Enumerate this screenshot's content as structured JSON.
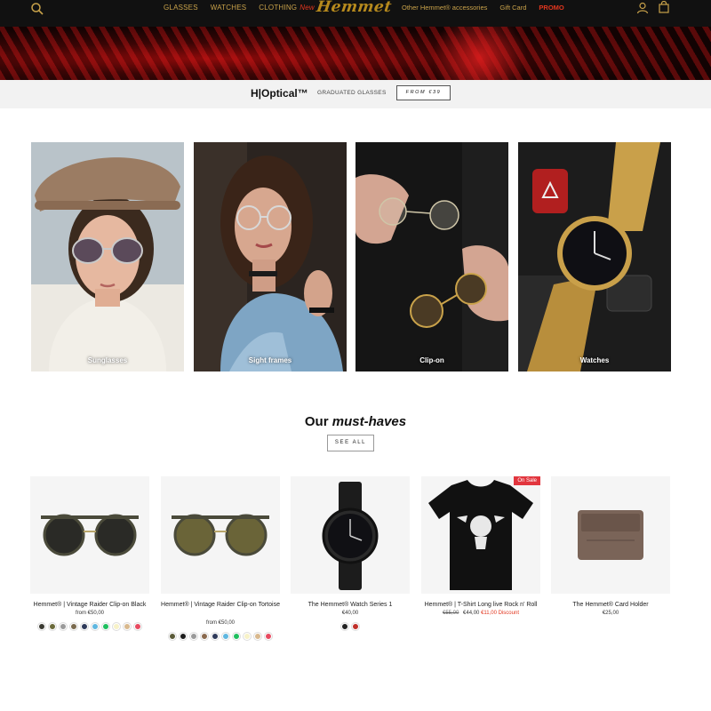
{
  "header": {
    "nav_left": [
      "GLASSES",
      "WATCHES",
      "CLOTHING"
    ],
    "clothing_badge": "New",
    "logo_text": "Hemmet",
    "nav_right": [
      "Other Hemmet® accessories",
      "Gift Card"
    ],
    "promo": "PROMO",
    "icons": [
      "search-icon",
      "account-icon",
      "cart-icon"
    ]
  },
  "optical": {
    "brand": "H|Optical™",
    "subtitle": "GRADUATED GLASSES",
    "button": "FROM €39"
  },
  "categories": [
    {
      "label": "Sunglasses"
    },
    {
      "label": "Sight frames"
    },
    {
      "label": "Clip-on"
    },
    {
      "label": "Watches"
    }
  ],
  "must_haves": {
    "title_prefix": "Our",
    "title_emph": "must-haves",
    "see_all": "SEE ALL"
  },
  "products": [
    {
      "name": "Hemmet® | Vintage Raider Clip-on Black",
      "price": "from €50,00",
      "swatches": [
        "#3a3a32",
        "#6b6a3a",
        "#9a9a9a",
        "#7a6a4e",
        "#2e3a5a",
        "#5fb7e0",
        "#1fbf5f",
        "#f7f2c8",
        "#d9b98e",
        "#e84a60"
      ]
    },
    {
      "name": "Hemmet® | Vintage Raider Clip-on Tortoise",
      "price": "from €50,00",
      "swatches": [
        "#5a5a38",
        "#1c1c1c",
        "#9a9a9a",
        "#8a6a4e",
        "#2e3a5a",
        "#5fb7e0",
        "#1fbf5f",
        "#f7f2c8",
        "#d9b98e",
        "#e84a60"
      ]
    },
    {
      "name": "The Hemmet® Watch Series 1",
      "price": "€40,00",
      "swatches": [
        "#222222",
        "#c0302a"
      ]
    },
    {
      "name": "Hemmet® | T-Shirt Long live Rock n' Roll",
      "price_old": "€55,00",
      "price": "€44,00",
      "discount": "€11,00 Discount",
      "badge": "On Sale"
    },
    {
      "name": "The Hemmet® Card Holder",
      "price": "€25,00"
    }
  ]
}
